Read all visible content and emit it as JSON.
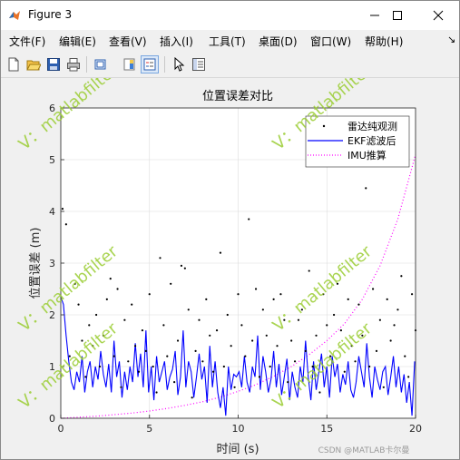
{
  "window": {
    "title": "Figure 3",
    "controls": {
      "minimize": "minimize",
      "maximize": "maximize",
      "close": "close"
    }
  },
  "menu": [
    {
      "label": "文件(F)"
    },
    {
      "label": "编辑(E)"
    },
    {
      "label": "查看(V)"
    },
    {
      "label": "插入(I)"
    },
    {
      "label": "工具(T)"
    },
    {
      "label": "桌面(D)"
    },
    {
      "label": "窗口(W)"
    },
    {
      "label": "帮助(H)"
    }
  ],
  "toolbar": {
    "icons": [
      "new-figure-icon",
      "open-file-icon",
      "save-icon",
      "print-icon",
      "link-plot-icon",
      "insert-colorbar-icon",
      "insert-legend-icon",
      "select-arrow-icon",
      "property-inspector-icon"
    ],
    "active": "insert-legend-icon"
  },
  "watermark": {
    "text": "V：matlabfilter",
    "color": "#9acd32"
  },
  "footer": {
    "text": "CSDN @MATLAB卡尔曼"
  },
  "chart_data": {
    "type": "line",
    "title": "位置误差对比",
    "xlabel": "时间 (s)",
    "ylabel": "位置误差 (m)",
    "xlim": [
      0,
      20
    ],
    "ylim": [
      0,
      6
    ],
    "xticks": [
      "0",
      "5",
      "10",
      "15",
      "20"
    ],
    "yticks": [
      "0",
      "1",
      "2",
      "3",
      "4",
      "5",
      "6"
    ],
    "grid": true,
    "legend_position": "top-right",
    "series": [
      {
        "name": "雷达纯观测",
        "style": "points",
        "color": "#000000",
        "x": [
          0.1,
          0.3,
          0.5,
          0.8,
          1.0,
          1.2,
          1.4,
          1.6,
          1.8,
          2.0,
          2.2,
          2.4,
          2.6,
          2.8,
          3.0,
          3.2,
          3.4,
          3.6,
          3.8,
          4.0,
          4.2,
          4.4,
          4.6,
          4.8,
          5.0,
          5.2,
          5.4,
          5.6,
          5.8,
          6.0,
          6.2,
          6.4,
          6.6,
          6.8,
          7.0,
          7.2,
          7.4,
          7.6,
          7.8,
          8.0,
          8.2,
          8.4,
          8.6,
          8.8,
          9.0,
          9.2,
          9.4,
          9.6,
          9.8,
          10.0,
          10.2,
          10.4,
          10.6,
          10.8,
          11.0,
          11.2,
          11.4,
          11.6,
          11.8,
          12.0,
          12.2,
          12.4,
          12.6,
          12.8,
          13.0,
          13.2,
          13.4,
          13.6,
          13.8,
          14.0,
          14.2,
          14.4,
          14.6,
          14.8,
          15.0,
          15.2,
          15.4,
          15.6,
          15.8,
          16.0,
          16.2,
          16.4,
          16.6,
          16.8,
          17.0,
          17.2,
          17.4,
          17.6,
          17.8,
          18.0,
          18.2,
          18.4,
          18.6,
          18.8,
          19.0,
          19.2,
          19.4,
          19.6,
          19.8,
          20.0
        ],
        "y": [
          4.05,
          3.75,
          1.2,
          2.6,
          2.2,
          1.5,
          0.8,
          1.8,
          1.4,
          2.0,
          1.0,
          1.6,
          2.3,
          2.7,
          1.2,
          2.5,
          0.6,
          1.9,
          1.1,
          2.2,
          1.4,
          0.9,
          1.7,
          1.3,
          2.4,
          1.0,
          0.5,
          3.1,
          1.8,
          1.2,
          2.6,
          0.7,
          1.5,
          2.95,
          2.9,
          2.1,
          0.4,
          1.3,
          1.9,
          1.1,
          2.3,
          1.6,
          0.9,
          1.7,
          3.2,
          1.0,
          2.0,
          1.4,
          0.6,
          2.4,
          1.8,
          1.2,
          3.85,
          1.5,
          2.5,
          0.8,
          2.1,
          1.6,
          1.0,
          2.3,
          1.4,
          2.4,
          1.9,
          0.7,
          1.5,
          1.1,
          1.9,
          2.1,
          1.3,
          2.85,
          1.0,
          1.6,
          0.5,
          2.4,
          1.8,
          1.2,
          2.0,
          2.6,
          1.7,
          0.9,
          2.3,
          1.4,
          1.1,
          2.2,
          1.6,
          4.45,
          1.0,
          2.5,
          1.3,
          1.9,
          0.6,
          2.3,
          1.5,
          1.8,
          2.1,
          2.75,
          1.2,
          0.8,
          2.4,
          1.7
        ]
      },
      {
        "name": "EKF滤波后",
        "style": "line",
        "color": "#0000ff",
        "x": [
          0.0,
          0.15,
          0.3,
          0.45,
          0.6,
          0.75,
          0.9,
          1.05,
          1.2,
          1.35,
          1.5,
          1.65,
          1.8,
          1.95,
          2.1,
          2.25,
          2.4,
          2.55,
          2.7,
          2.85,
          3.0,
          3.15,
          3.3,
          3.45,
          3.6,
          3.75,
          3.9,
          4.05,
          4.2,
          4.35,
          4.5,
          4.65,
          4.8,
          4.95,
          5.1,
          5.25,
          5.4,
          5.55,
          5.7,
          5.85,
          6.0,
          6.15,
          6.3,
          6.45,
          6.6,
          6.75,
          6.9,
          7.05,
          7.2,
          7.35,
          7.5,
          7.65,
          7.8,
          7.95,
          8.1,
          8.25,
          8.4,
          8.55,
          8.7,
          8.85,
          9.0,
          9.15,
          9.3,
          9.45,
          9.6,
          9.75,
          9.9,
          10.05,
          10.2,
          10.35,
          10.5,
          10.65,
          10.8,
          10.95,
          11.1,
          11.25,
          11.4,
          11.55,
          11.7,
          11.85,
          12.0,
          12.15,
          12.3,
          12.45,
          12.6,
          12.75,
          12.9,
          13.05,
          13.2,
          13.35,
          13.5,
          13.65,
          13.8,
          13.95,
          14.1,
          14.25,
          14.4,
          14.55,
          14.7,
          14.85,
          15.0,
          15.15,
          15.3,
          15.45,
          15.6,
          15.75,
          15.9,
          16.05,
          16.2,
          16.35,
          16.5,
          16.65,
          16.8,
          16.95,
          17.1,
          17.25,
          17.4,
          17.55,
          17.7,
          17.85,
          18.0,
          18.15,
          18.3,
          18.45,
          18.6,
          18.75,
          18.9,
          19.05,
          19.2,
          19.35,
          19.5,
          19.65,
          19.8,
          19.95
        ],
        "y": [
          2.35,
          2.2,
          1.6,
          1.1,
          0.7,
          0.55,
          0.9,
          0.7,
          1.2,
          0.5,
          0.9,
          1.1,
          0.6,
          1.0,
          0.75,
          1.3,
          0.85,
          0.6,
          1.05,
          0.5,
          1.5,
          0.8,
          1.1,
          0.4,
          0.9,
          0.55,
          1.0,
          0.7,
          1.45,
          0.8,
          1.25,
          0.6,
          1.7,
          0.5,
          1.0,
          0.35,
          1.2,
          0.7,
          0.9,
          1.1,
          0.55,
          0.8,
          0.95,
          1.3,
          0.45,
          0.8,
          1.7,
          0.6,
          1.1,
          0.9,
          0.4,
          0.8,
          1.25,
          0.75,
          1.0,
          0.3,
          1.4,
          0.6,
          1.1,
          0.5,
          0.2,
          0.6,
          0.05,
          1.0,
          0.55,
          0.85,
          0.8,
          0.9,
          0.6,
          1.2,
          0.7,
          0.5,
          1.0,
          0.8,
          1.6,
          0.55,
          1.2,
          0.9,
          0.5,
          0.75,
          1.3,
          0.6,
          1.05,
          0.45,
          0.8,
          1.15,
          0.35,
          0.9,
          0.6,
          0.4,
          1.0,
          0.7,
          1.5,
          0.8,
          0.35,
          1.1,
          0.55,
          0.9,
          1.25,
          0.6,
          1.0,
          0.4,
          1.2,
          0.8,
          1.05,
          0.5,
          0.85,
          0.65,
          1.1,
          0.55,
          0.4,
          0.7,
          1.2,
          0.9,
          0.6,
          1.45,
          0.8,
          0.4,
          1.0,
          0.75,
          0.55,
          0.9,
          1.0,
          0.45,
          0.8,
          1.2,
          0.6,
          1.0,
          0.5,
          0.85,
          0.3,
          0.7,
          0.05,
          1.1
        ]
      },
      {
        "name": "IMU推算",
        "style": "dotted",
        "color": "#ff00ff",
        "x": [
          0,
          1,
          2,
          3,
          4,
          5,
          6,
          7,
          8,
          9,
          10,
          11,
          12,
          13,
          14,
          15,
          16,
          17,
          18,
          19,
          20
        ],
        "y": [
          0.0,
          0.02,
          0.04,
          0.07,
          0.1,
          0.14,
          0.19,
          0.25,
          0.32,
          0.41,
          0.52,
          0.65,
          0.81,
          1.0,
          1.23,
          1.5,
          1.83,
          2.3,
          2.95,
          3.85,
          5.1
        ]
      }
    ]
  }
}
